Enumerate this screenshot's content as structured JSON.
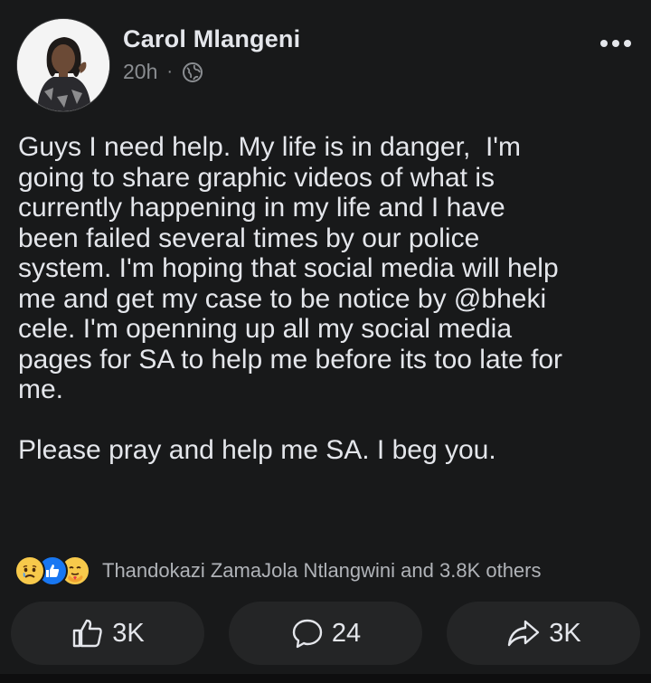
{
  "post": {
    "author": "Carol Mlangeni",
    "time": "20h",
    "separator": "·",
    "privacy_icon": "globe-icon",
    "more_icon": "more-horizontal-icon",
    "text": "Guys I need help. My life is in danger,  I'm\ngoing to share graphic videos of what is\ncurrently happening in my life and I have\nbeen failed several times by our police\nsystem. I'm hoping that social media will help\nme and get my case to be notice by @bheki\ncele. I'm openning up all my social media\npages for SA to help me before its too late for\nme.\n\nPlease pray and help me SA. I beg you."
  },
  "reactions": {
    "icons": [
      "sad-reaction-icon",
      "like-reaction-icon",
      "care-reaction-icon"
    ],
    "summary": "Thandokazi ZamaJola Ntlangwini and 3.8K others"
  },
  "actions": {
    "like": {
      "icon": "thumbs-up-icon",
      "count": "3K"
    },
    "comment": {
      "icon": "comment-icon",
      "count": "24"
    },
    "share": {
      "icon": "share-icon",
      "count": "3K"
    }
  },
  "colors": {
    "background": "#18191a",
    "button_bg": "#242526",
    "text_primary": "#e4e6eb",
    "text_secondary": "#b0b3b8",
    "like_blue": "#1877f2"
  }
}
